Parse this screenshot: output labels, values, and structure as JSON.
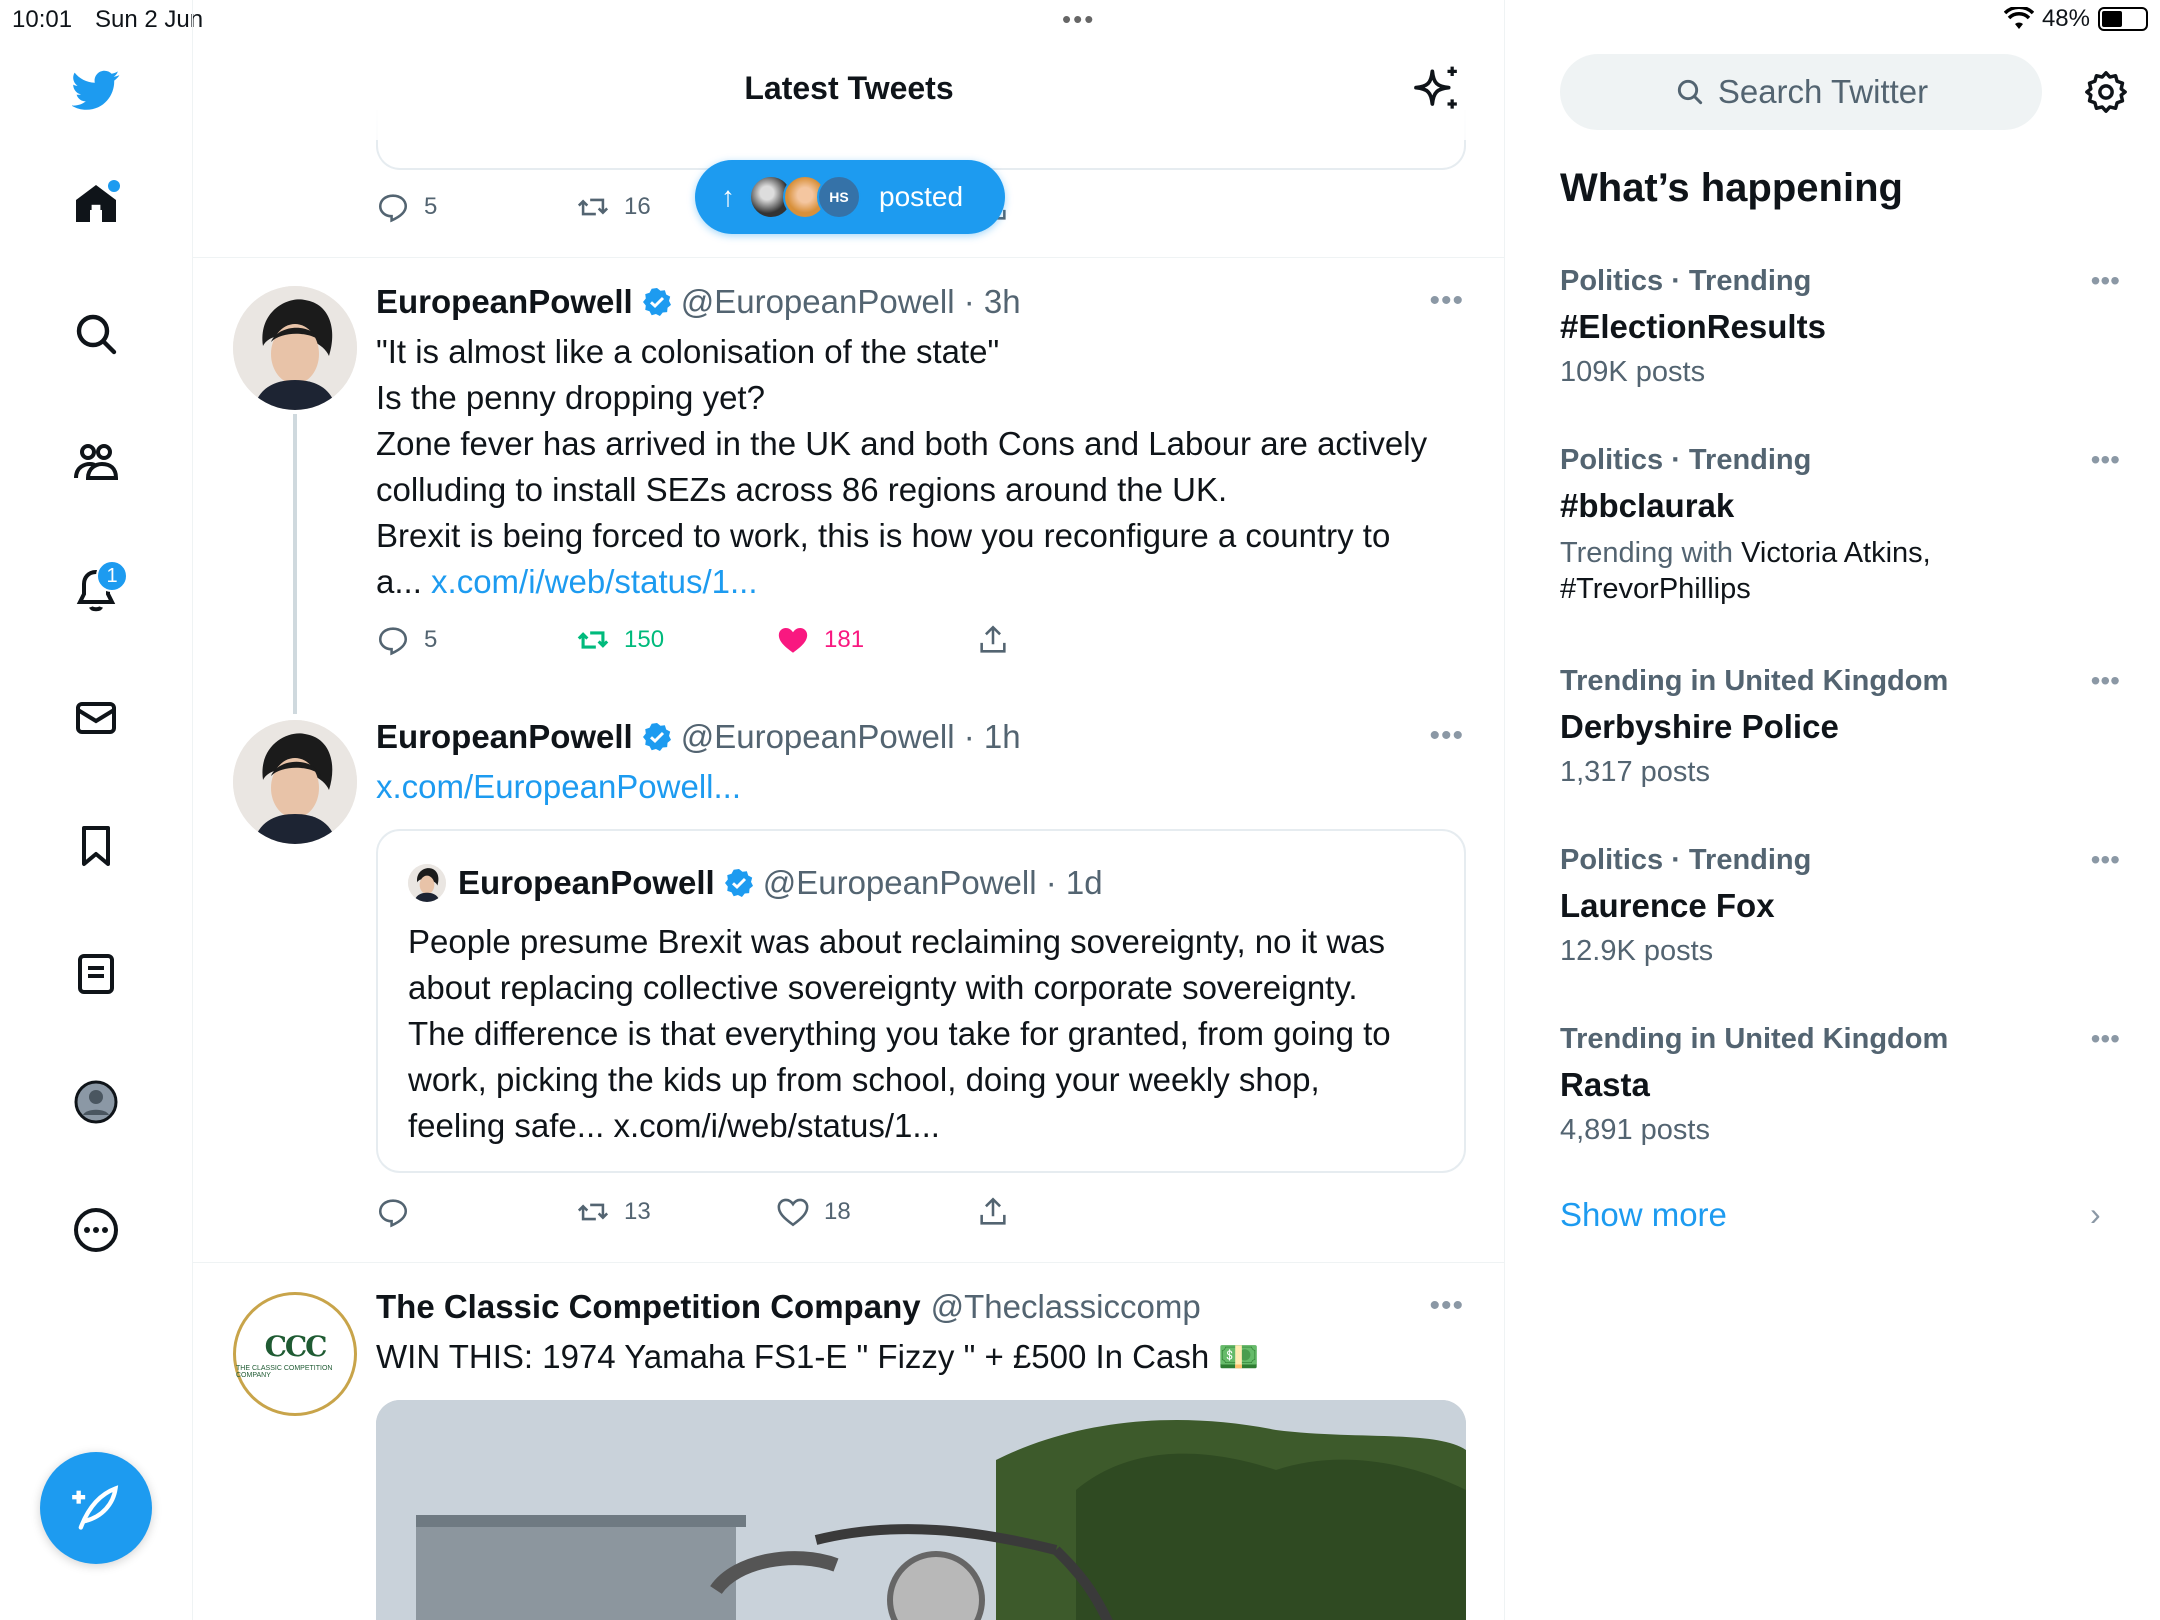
{
  "status_bar": {
    "time": "10:01",
    "date": "Sun 2 Jun",
    "battery": "48%"
  },
  "left_nav": {
    "notifications_badge": "1"
  },
  "header": {
    "title": "Latest Tweets"
  },
  "prev_tweet": {
    "replies": "5",
    "retweets": "16"
  },
  "posted_pill": {
    "label": "posted",
    "avatar3_text": "HS"
  },
  "tweets": [
    {
      "name": "EuropeanPowell",
      "handle": "@EuropeanPowell",
      "time": "3h",
      "lines": [
        "\"It is almost like a colonisation of the state\"",
        "Is the penny dropping yet?",
        "Zone fever has arrived in the UK and both Cons and Labour are actively",
        "colluding to install SEZs across 86 regions around the UK.",
        "Brexit is being forced to work, this is how you reconfigure a country to"
      ],
      "last_line_prefix": "a...",
      "link": "x.com/i/web/status/1...",
      "replies": "5",
      "retweets": "150",
      "likes": "181"
    },
    {
      "name": "EuropeanPowell",
      "handle": "@EuropeanPowell",
      "time": "1h",
      "link": "x.com/EuropeanPowell...",
      "quote": {
        "name": "EuropeanPowell",
        "handle": "@EuropeanPowell",
        "time": "1d",
        "lines": [
          "People presume Brexit was about reclaiming sovereignty, no it was",
          "about replacing collective sovereignty with corporate sovereignty.",
          "The difference is that everything you take for granted, from going to",
          "work, picking the kids up from school, doing your weekly shop,",
          "feeling safe... x.com/i/web/status/1..."
        ]
      },
      "replies": "",
      "retweets": "13",
      "likes": "18"
    },
    {
      "name": "The Classic Competition Company",
      "handle": "@Theclassiccomp",
      "text": "WIN THIS: 1974 Yamaha FS1-E \" Fizzy \" + £500 In Cash 💵",
      "avatar_logo": "CCC",
      "avatar_sub": "THE CLASSIC COMPETITION COMPANY"
    }
  ],
  "sidebar": {
    "search_placeholder": "Search Twitter",
    "title": "What’s happening",
    "trends": [
      {
        "context": "Politics · Trending",
        "name": "#ElectionResults",
        "count": "109K posts"
      },
      {
        "context": "Politics · Trending",
        "name": "#bbclaurak",
        "with_prefix": "Trending with",
        "with_names": "Victoria Atkins,",
        "with_names2": "#TrevorPhillips"
      },
      {
        "context": "Trending in United Kingdom",
        "name": "Derbyshire Police",
        "count": "1,317 posts"
      },
      {
        "context": "Politics · Trending",
        "name": "Laurence Fox",
        "count": "12.9K posts"
      },
      {
        "context": "Trending in United Kingdom",
        "name": "Rasta",
        "count": "4,891 posts"
      }
    ],
    "show_more": "Show more"
  },
  "colors": {
    "accent": "#1d9bf0",
    "like": "#f91880",
    "retweet": "#00ba7c",
    "muted": "#536471"
  },
  "icons": [
    "twitter-logo-icon",
    "home-icon",
    "search-icon",
    "communities-icon",
    "bell-icon",
    "mail-icon",
    "bookmark-icon",
    "lists-icon",
    "profile-icon",
    "more-icon",
    "compose-icon",
    "sparkle-icon",
    "settings-icon",
    "reply-icon",
    "retweet-icon",
    "like-icon",
    "share-icon",
    "verified-icon"
  ]
}
